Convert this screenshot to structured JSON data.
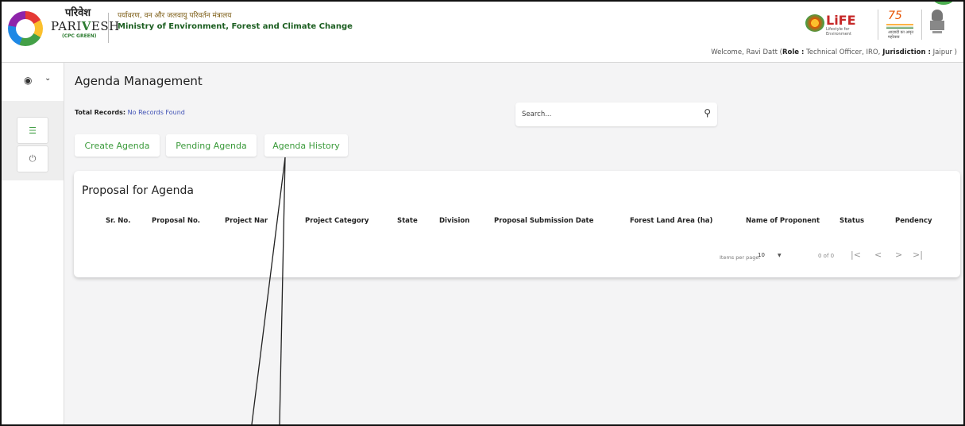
{
  "header": {
    "brand_hindi": "परिवेश",
    "brand_english_pre": "PARI",
    "brand_english_check": "V",
    "brand_english_post": "ESH",
    "brand_sub": "(CPC GREEN)",
    "ministry_hindi": "पर्यावरण, वन और जलवायु परिवर्तन मंत्रालय",
    "ministry_english": "Ministry of Environment, Forest and Climate Change",
    "life_text": "LiFE",
    "life_sub": "Lifestyle for Environment",
    "azadi_text": "75",
    "azadi_sub": "आज़ादी का अमृत महोत्सव",
    "welcome_prefix": "Welcome, Ravi Datt (",
    "role_label": "Role :",
    "role_value": " Technical Officer, IRO,",
    "jurisdiction_label": " Jurisdiction :",
    "jurisdiction_value": " Jaipur )"
  },
  "sidebar": {
    "user_icon": "user-circle-icon",
    "chevron_icon": "chevron-down-icon",
    "items": [
      {
        "icon": "list-icon",
        "glyph": "☰"
      },
      {
        "icon": "power-icon",
        "glyph": "⏻"
      }
    ]
  },
  "main": {
    "title": "Agenda Management",
    "total_label": "Total Records:",
    "total_value": " No Records Found",
    "search_placeholder": "Search...",
    "tabs": [
      {
        "label": "Create Agenda"
      },
      {
        "label": "Pending Agenda"
      },
      {
        "label": "Agenda History"
      }
    ]
  },
  "table": {
    "title": "Proposal for Agenda",
    "columns": [
      "Sr. No.",
      "Proposal No.",
      "Project Nar",
      "Project Category",
      "State",
      "Division",
      "Proposal Submission Date",
      "Forest Land Area (ha)",
      "Name of Proponent",
      "Status",
      "Pendency"
    ],
    "rows": []
  },
  "pagination": {
    "items_per_page_label": "Items per page:",
    "items_per_page_value": "10",
    "range": "0 of 0",
    "first": "|<",
    "prev": "<",
    "next": ">",
    "last": ">|"
  },
  "colors": {
    "accent_green": "#3a9a3a",
    "link_blue": "#3f51b5"
  }
}
